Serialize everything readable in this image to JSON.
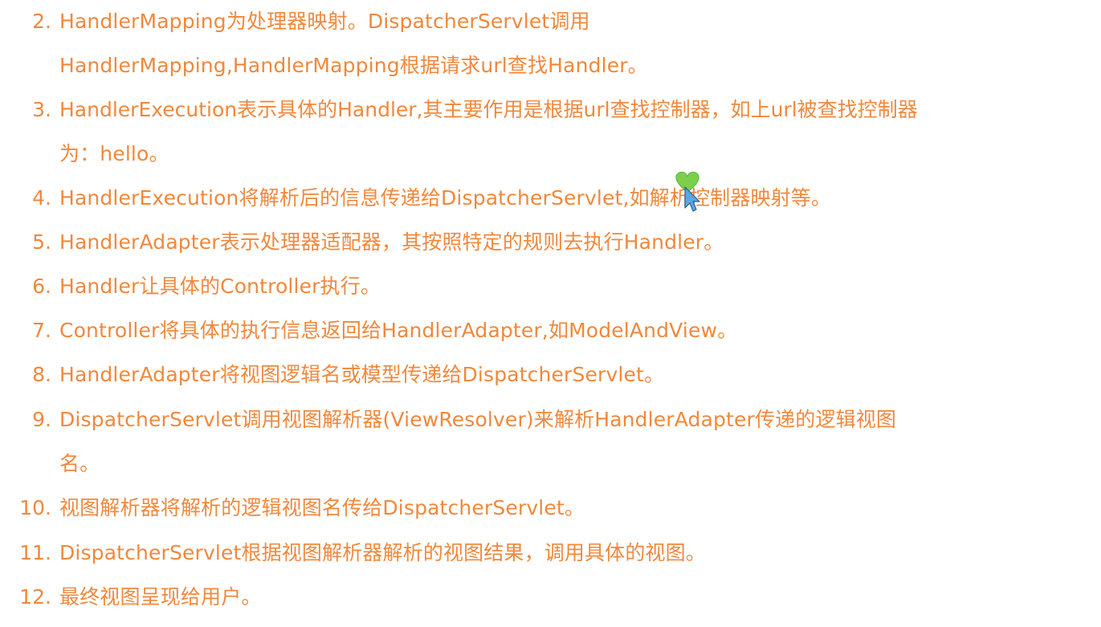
{
  "items": [
    {
      "number": "2.",
      "lines": [
        "HandlerMapping为处理器映射。DispatcherServlet调用",
        "HandlerMapping,HandlerMapping根据请求url查找Handler。"
      ]
    },
    {
      "number": "3.",
      "lines": [
        "HandlerExecution表示具体的Handler,其主要作用是根据url查找控制器，如上url被查找控制器",
        "为：hello。"
      ]
    },
    {
      "number": "4.",
      "lines": [
        "HandlerExecution将解析后的信息传递给DispatcherServlet,如解析控制器映射等。"
      ]
    },
    {
      "number": "5.",
      "lines": [
        "HandlerAdapter表示处理器适配器，其按照特定的规则去执行Handler。"
      ]
    },
    {
      "number": "6.",
      "lines": [
        "Handler让具体的Controller执行。"
      ]
    },
    {
      "number": "7.",
      "lines": [
        "Controller将具体的执行信息返回给HandlerAdapter,如ModelAndView。"
      ]
    },
    {
      "number": "8.",
      "lines": [
        "HandlerAdapter将视图逻辑名或模型传递给DispatcherServlet。"
      ]
    },
    {
      "number": "9.",
      "lines": [
        "DispatcherServlet调用视图解析器(ViewResolver)来解析HandlerAdapter传递的逻辑视图",
        "名。"
      ]
    },
    {
      "number": "10.",
      "lines": [
        "视图解析器将解析的逻辑视图名传给DispatcherServlet。"
      ]
    },
    {
      "number": "11.",
      "lines": [
        "DispatcherServlet根据视图解析器解析的视图结果，调用具体的视图。"
      ]
    },
    {
      "number": "12.",
      "lines": [
        "最终视图呈现给用户。"
      ]
    }
  ],
  "colors": {
    "text": "#f0883c",
    "background": "#ffffff",
    "cursor_heart": "#7ccf4a",
    "cursor_arrow": "#5aa6e0"
  },
  "icons": {
    "cursor": "green-heart-hand-cursor-icon"
  }
}
